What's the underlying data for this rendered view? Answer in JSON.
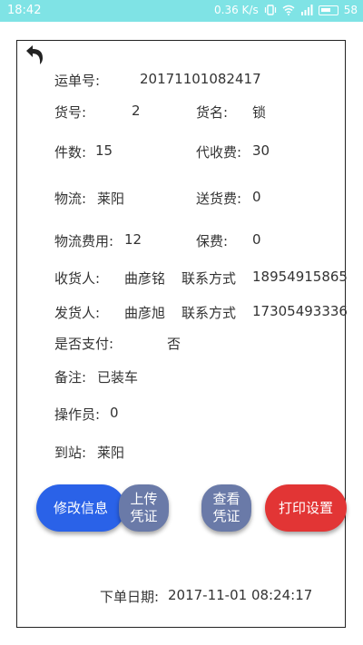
{
  "status_bar": {
    "time": "18:42",
    "speed": "0.36 K/s",
    "battery": "58"
  },
  "order": {
    "waybill_label": "运单号:",
    "waybill_value": "20171101082417",
    "goods_no_label": "货号:",
    "goods_no_value": "2",
    "goods_name_label": "货名:",
    "goods_name_value": "锁",
    "pieces_label": "件数:",
    "pieces_value": "15",
    "cod_fee_label": "代收费:",
    "cod_fee_value": "30",
    "logistics_label": "物流:",
    "logistics_value": "莱阳",
    "delivery_fee_label": "送货费:",
    "delivery_fee_value": "0",
    "logistics_cost_label": "物流费用:",
    "logistics_cost_value": "12",
    "insurance_label": "保费:",
    "insurance_value": "0",
    "receiver_label": "收货人:",
    "receiver_value": "曲彦铭",
    "receiver_contact_label": "联系方式",
    "receiver_contact_value": "18954915865",
    "sender_label": "发货人:",
    "sender_value": "曲彦旭",
    "sender_contact_label": "联系方式",
    "sender_contact_value": "17305493336",
    "paid_label": "是否支付:",
    "paid_value": "否",
    "remark_label": "备注:",
    "remark_value": "已装车",
    "operator_label": "操作员:",
    "operator_value": "0",
    "station_label": "到站:",
    "station_value": "莱阳",
    "order_date_label": "下单日期:",
    "order_date_value": "2017-11-01 08:24:17"
  },
  "buttons": {
    "edit": "修改信息",
    "upload": "上传凭证",
    "view": "查看凭证",
    "print": "打印设置"
  },
  "colors": {
    "status_bar": "#7fe3e5",
    "edit_button": "#2a62e8",
    "voucher_buttons": "#6a7aa8",
    "print_button": "#e23535"
  }
}
